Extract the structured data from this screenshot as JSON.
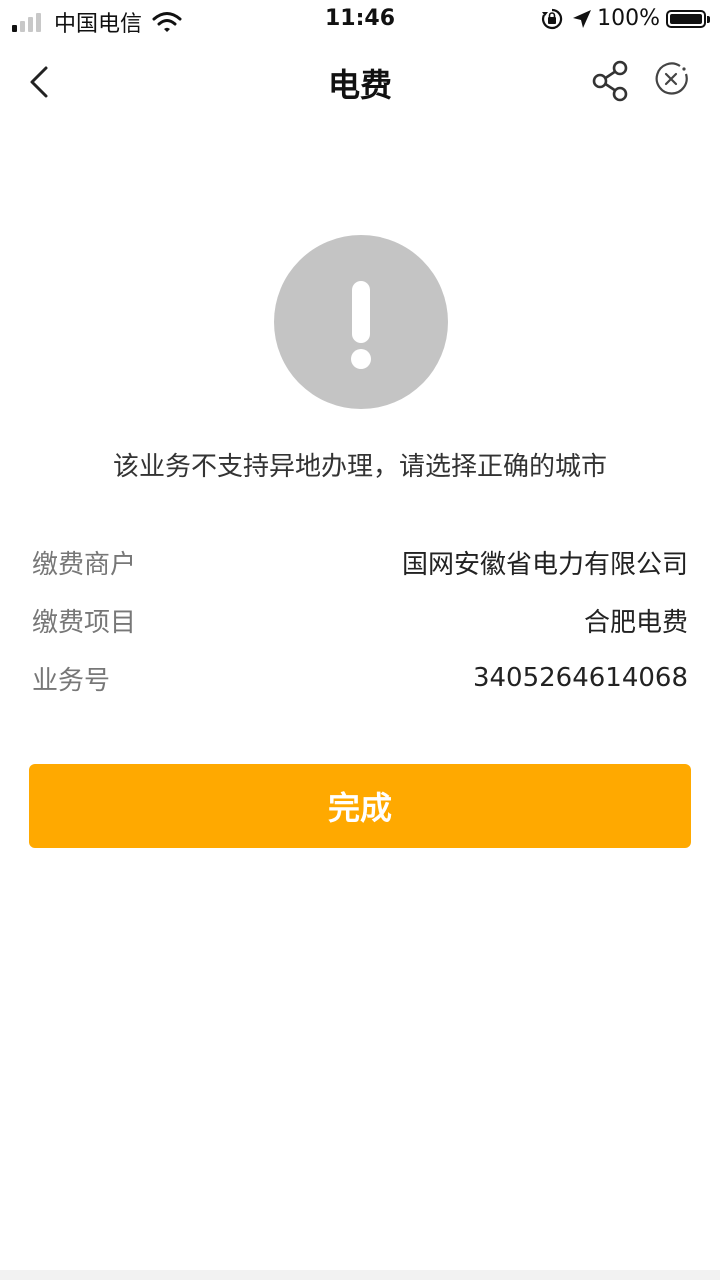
{
  "status_bar": {
    "carrier": "中国电信",
    "time": "11:46",
    "battery": "100%"
  },
  "nav": {
    "title": "电费",
    "back_icon": "chevron-left-icon",
    "share_icon": "share-icon",
    "close_icon": "close-circle-icon"
  },
  "result": {
    "icon": "exclamation-circle-icon",
    "message": "该业务不支持异地办理，请选择正确的城市"
  },
  "details": [
    {
      "label": "缴费商户",
      "value": "国网安徽省电力有限公司"
    },
    {
      "label": "缴费项目",
      "value": "合肥电费"
    },
    {
      "label": "业务号",
      "value": "3405264614068"
    }
  ],
  "done_button": {
    "label": "完成"
  },
  "colors": {
    "accent": "#ffa900",
    "alert_circle": "#c4c4c4"
  }
}
